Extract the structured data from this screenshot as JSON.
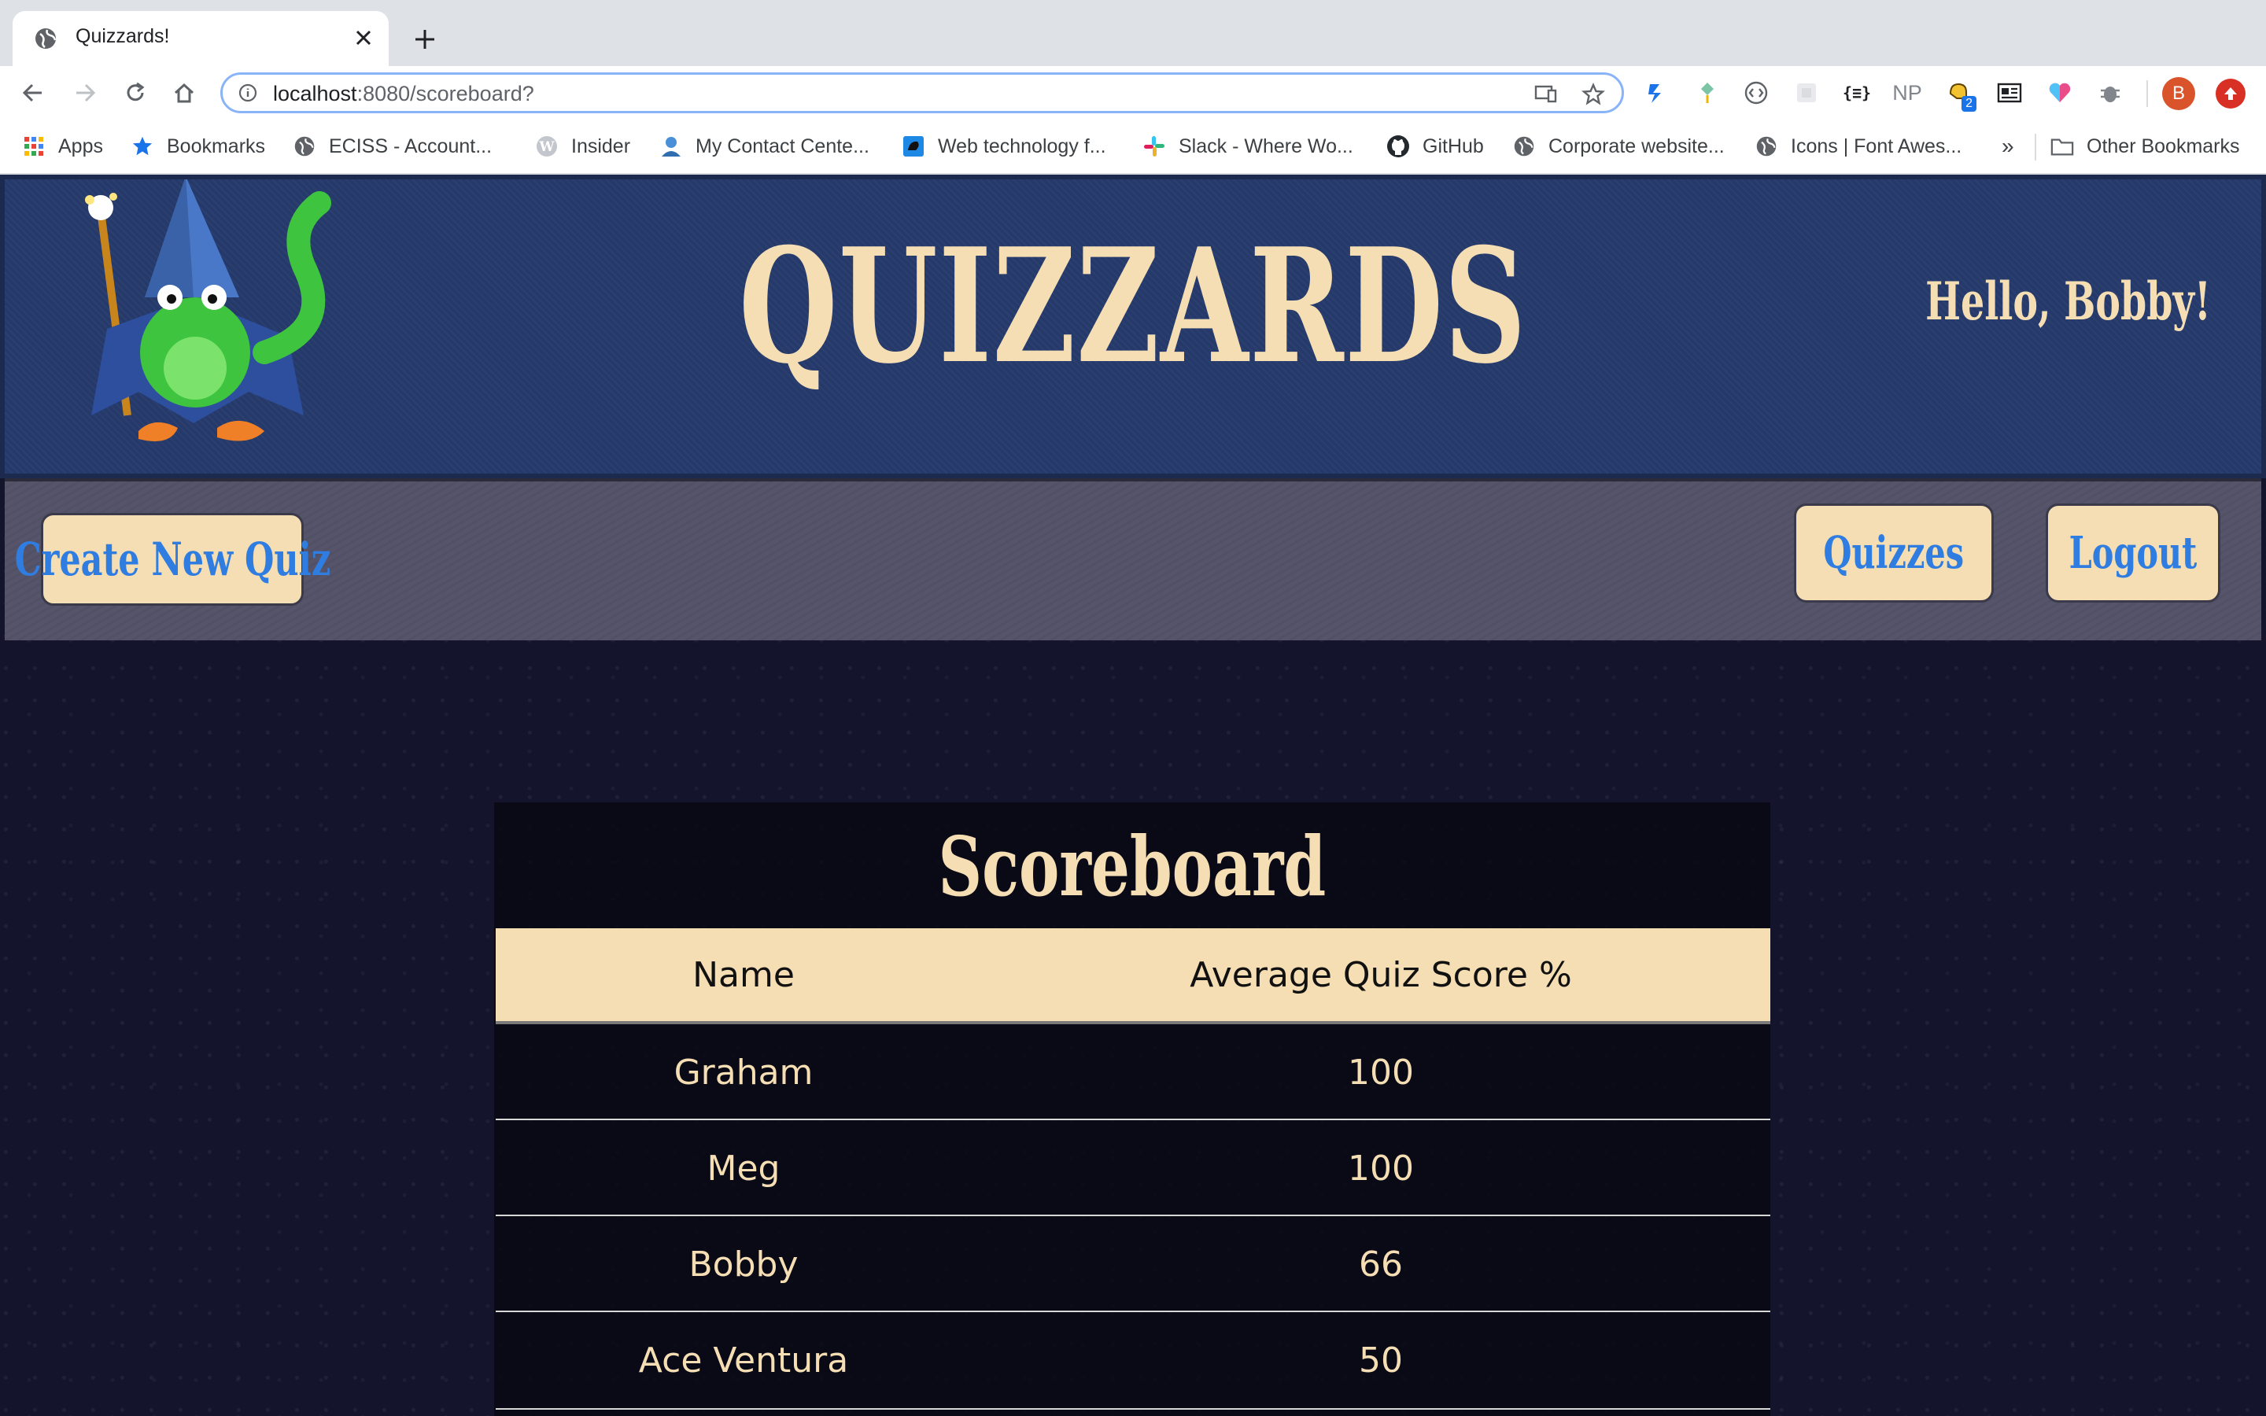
{
  "browser": {
    "tab": {
      "title": "Quizzards!"
    },
    "address": {
      "host": "localhost",
      "path": ":8080/scoreboard?"
    },
    "bookmarks": [
      {
        "label": "Apps",
        "icon": "apps-grid-icon"
      },
      {
        "label": "Bookmarks",
        "icon": "star-icon"
      },
      {
        "label": "ECISS - Account...",
        "icon": "globe-icon"
      },
      {
        "label": "Insider",
        "icon": "wordpress-icon"
      },
      {
        "label": "My Contact Cente...",
        "icon": "contact-icon"
      },
      {
        "label": "Web technology f...",
        "icon": "web-tech-icon"
      },
      {
        "label": "Slack - Where Wo...",
        "icon": "slack-icon"
      },
      {
        "label": "GitHub",
        "icon": "github-icon"
      },
      {
        "label": "Corporate website...",
        "icon": "globe-icon"
      },
      {
        "label": "Icons | Font Awes...",
        "icon": "globe-icon"
      }
    ],
    "bookmarks_overflow": "»",
    "other_bookmarks": "Other Bookmarks",
    "extensions": [
      "NP"
    ],
    "extension_badge": "2",
    "profile_initial": "B"
  },
  "header": {
    "title": "QUIZZARDS",
    "greeting": "Hello, Bobby!"
  },
  "nav": {
    "create_quiz": "Create New Quiz",
    "quizzes": "Quizzes",
    "logout": "Logout"
  },
  "scoreboard": {
    "title": "Scoreboard",
    "columns": [
      "Name",
      "Average Quiz Score %"
    ],
    "rows": [
      {
        "name": "Graham",
        "score": "100"
      },
      {
        "name": "Meg",
        "score": "100"
      },
      {
        "name": "Bobby",
        "score": "66"
      },
      {
        "name": "Ace Ventura",
        "score": "50"
      }
    ]
  },
  "colors": {
    "header_bg": "#253a6b",
    "accent_cream": "#f5deb3",
    "button_text": "#2f7de0",
    "navbar_bg": "#55546a"
  }
}
